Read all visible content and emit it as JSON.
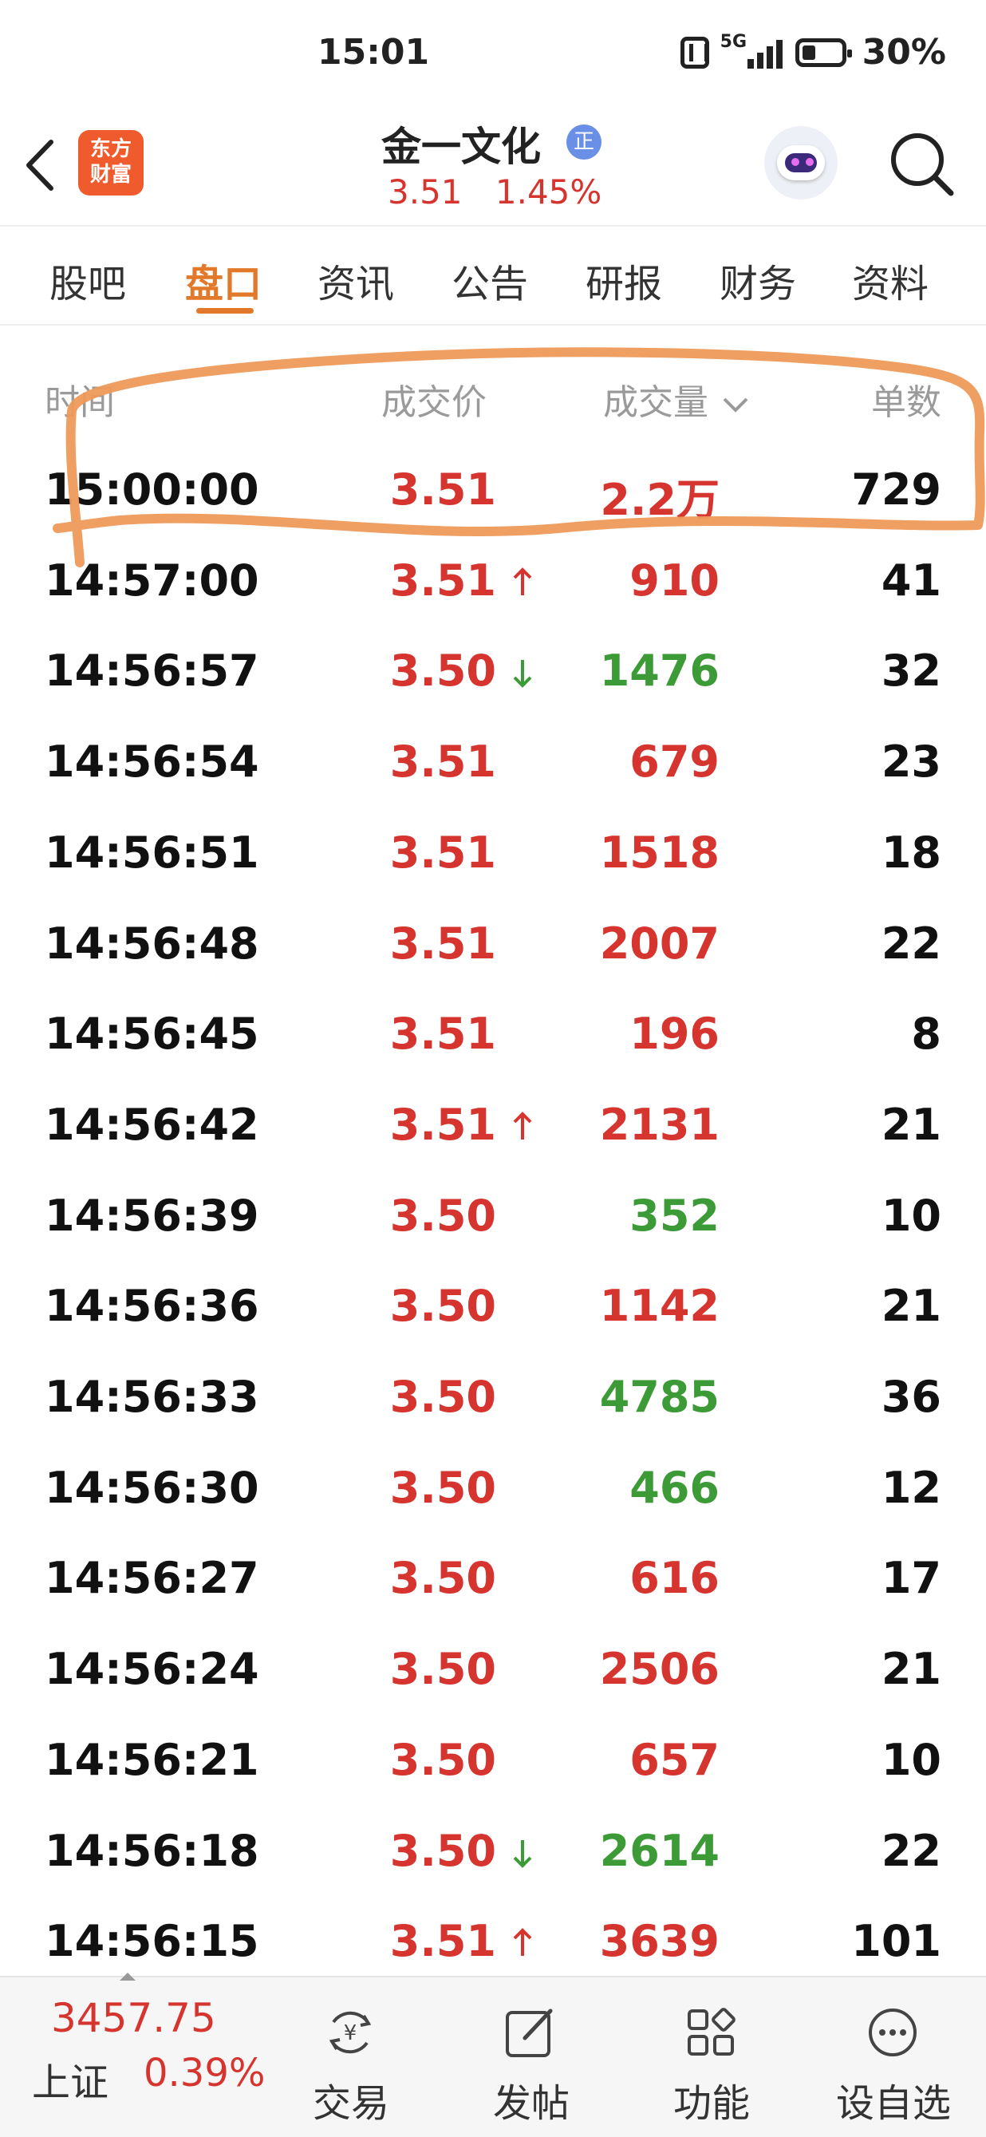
{
  "status_bar": {
    "time": "15:01",
    "network": "5G",
    "battery": "30%"
  },
  "header": {
    "logo": {
      "line1": "东方",
      "line2": "财富"
    },
    "stock_name": "金一文化",
    "badge": "正",
    "price": "3.51",
    "change_pct": "1.45%"
  },
  "tabs": [
    {
      "label": "股吧"
    },
    {
      "label": "盘口",
      "active": true
    },
    {
      "label": "资讯"
    },
    {
      "label": "公告"
    },
    {
      "label": "研报"
    },
    {
      "label": "财务"
    },
    {
      "label": "资料"
    }
  ],
  "table": {
    "columns": {
      "time": "时间",
      "price": "成交价",
      "volume": "成交量",
      "count": "单数"
    },
    "rows": [
      {
        "time": "15:00:00",
        "price": "3.51",
        "arrow": "",
        "volume": "2.2万",
        "volume_color": "red",
        "count": "729"
      },
      {
        "time": "14:57:00",
        "price": "3.51",
        "arrow": "up",
        "volume": "910",
        "volume_color": "red",
        "count": "41"
      },
      {
        "time": "14:56:57",
        "price": "3.50",
        "arrow": "down",
        "volume": "1476",
        "volume_color": "green",
        "count": "32"
      },
      {
        "time": "14:56:54",
        "price": "3.51",
        "arrow": "",
        "volume": "679",
        "volume_color": "red",
        "count": "23"
      },
      {
        "time": "14:56:51",
        "price": "3.51",
        "arrow": "",
        "volume": "1518",
        "volume_color": "red",
        "count": "18"
      },
      {
        "time": "14:56:48",
        "price": "3.51",
        "arrow": "",
        "volume": "2007",
        "volume_color": "red",
        "count": "22"
      },
      {
        "time": "14:56:45",
        "price": "3.51",
        "arrow": "",
        "volume": "196",
        "volume_color": "red",
        "count": "8"
      },
      {
        "time": "14:56:42",
        "price": "3.51",
        "arrow": "up",
        "volume": "2131",
        "volume_color": "red",
        "count": "21"
      },
      {
        "time": "14:56:39",
        "price": "3.50",
        "arrow": "",
        "volume": "352",
        "volume_color": "green",
        "count": "10"
      },
      {
        "time": "14:56:36",
        "price": "3.50",
        "arrow": "",
        "volume": "1142",
        "volume_color": "red",
        "count": "21"
      },
      {
        "time": "14:56:33",
        "price": "3.50",
        "arrow": "",
        "volume": "4785",
        "volume_color": "green",
        "count": "36"
      },
      {
        "time": "14:56:30",
        "price": "3.50",
        "arrow": "",
        "volume": "466",
        "volume_color": "green",
        "count": "12"
      },
      {
        "time": "14:56:27",
        "price": "3.50",
        "arrow": "",
        "volume": "616",
        "volume_color": "red",
        "count": "17"
      },
      {
        "time": "14:56:24",
        "price": "3.50",
        "arrow": "",
        "volume": "2506",
        "volume_color": "red",
        "count": "21"
      },
      {
        "time": "14:56:21",
        "price": "3.50",
        "arrow": "",
        "volume": "657",
        "volume_color": "red",
        "count": "10"
      },
      {
        "time": "14:56:18",
        "price": "3.50",
        "arrow": "down",
        "volume": "2614",
        "volume_color": "green",
        "count": "22"
      },
      {
        "time": "14:56:15",
        "price": "3.51",
        "arrow": "up",
        "volume": "3639",
        "volume_color": "red",
        "count": "101"
      }
    ]
  },
  "bottom_bar": {
    "index_value": "3457.75",
    "index_name": "上证",
    "index_pct": "0.39%",
    "nav": [
      {
        "label": "交易",
        "icon": "trade-icon"
      },
      {
        "label": "发帖",
        "icon": "post-icon"
      },
      {
        "label": "功能",
        "icon": "function-icon"
      },
      {
        "label": "设自选",
        "icon": "watchlist-icon"
      }
    ]
  },
  "colors": {
    "red": "#d6342e",
    "green": "#3d9b37",
    "accent": "#e2792a",
    "annotation": "#ee9a5a"
  }
}
